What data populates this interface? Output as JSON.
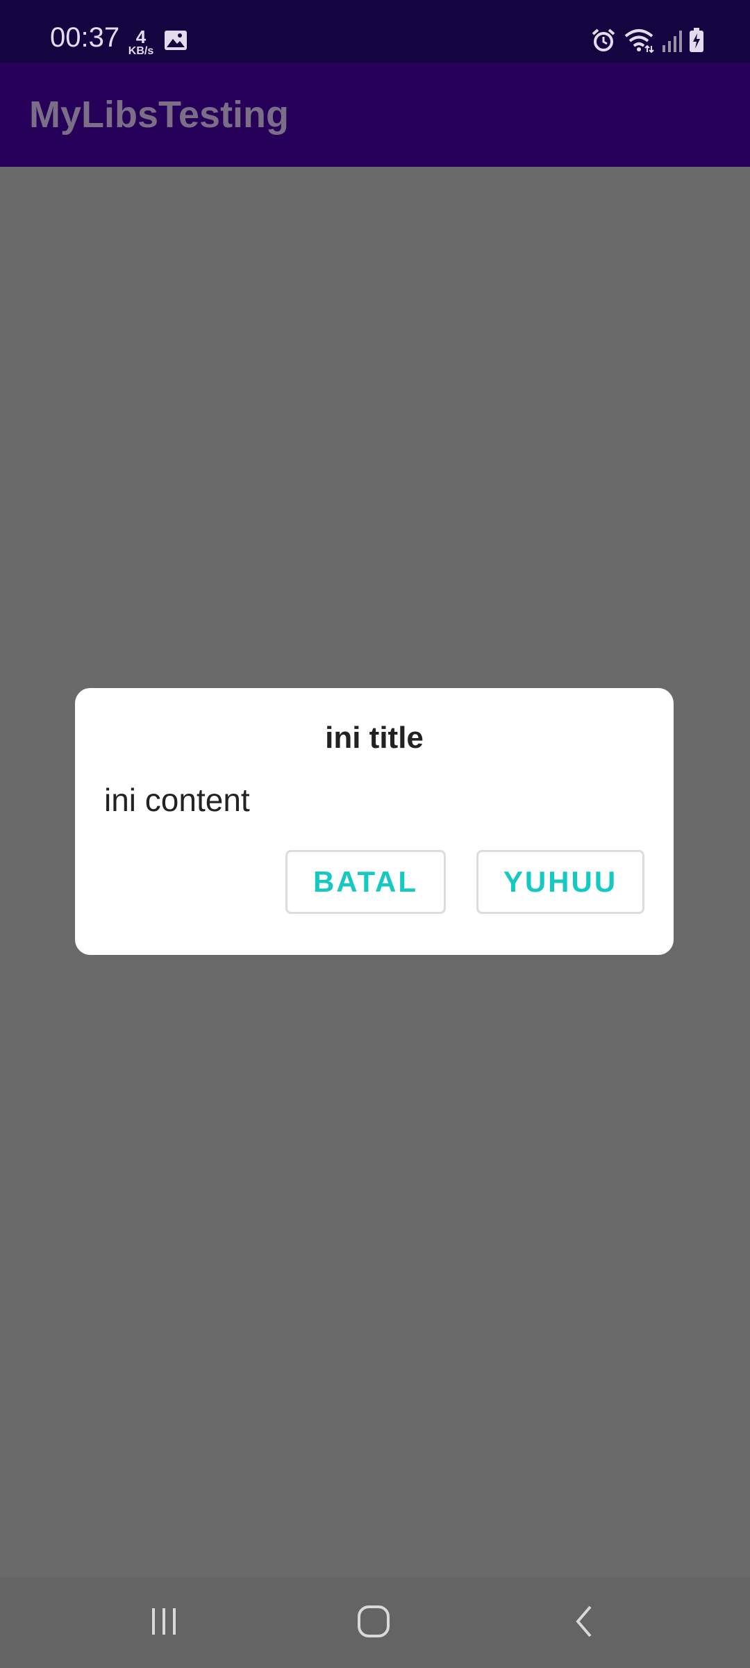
{
  "status_bar": {
    "time": "00:37",
    "speed_value": "4",
    "speed_unit": "KB/s",
    "icons": [
      "gallery-icon",
      "alarm-icon",
      "wifi-icon",
      "signal-icon",
      "battery-charging-icon"
    ]
  },
  "app_bar": {
    "title": "MyLibsTesting"
  },
  "dialog": {
    "title": "ini title",
    "content": "ini content",
    "negative_label": "BATAL",
    "positive_label": "YUHUU"
  },
  "nav_bar": {
    "icons": [
      "recent-apps-icon",
      "home-icon",
      "back-icon"
    ]
  },
  "colors": {
    "status_bar": "#140540",
    "app_bar": "#270059",
    "scrim": "#6a6a6a",
    "accent": "#14c9c2"
  }
}
